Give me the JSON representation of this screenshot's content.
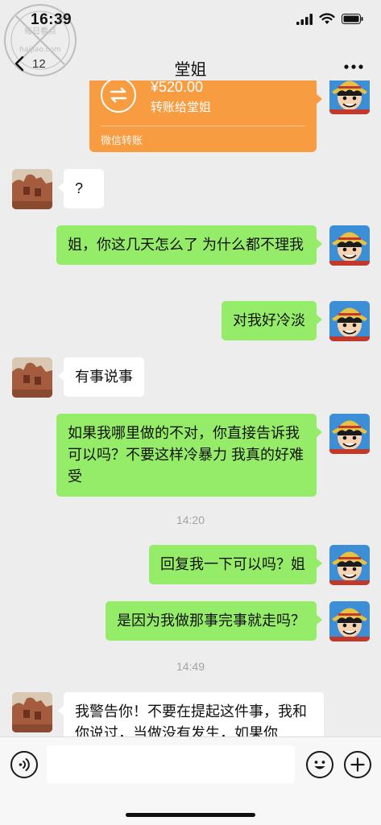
{
  "status": {
    "time": "16:39",
    "icons": [
      "cellular-signal-icon",
      "wifi-icon",
      "battery-icon"
    ]
  },
  "watermark": {
    "line1": "每日看点",
    "line2": "haijiao.com",
    "icon": "watermark-stamp"
  },
  "header": {
    "back_icon": "chevron-left-icon",
    "unread_count": "12",
    "title": "堂姐",
    "more_icon": "more-dots-icon"
  },
  "messages": {
    "transfer": {
      "amount": "¥520.00",
      "desc": "转账给堂姐",
      "footer": "微信转账",
      "icon": "transfer-arrows-icon"
    },
    "m1": "?",
    "m2": "姐，你这几天怎么了 为什么都不理我",
    "m3": "对我好冷淡",
    "m4": "有事说事",
    "m5": "如果我哪里做的不对，你直接告诉我可以吗？不要这样冷暴力 我真的好难受",
    "ts1": "14:20",
    "m6": "回复我一下可以吗？姐",
    "m7": "是因为我做那事完事就走吗？",
    "ts2": "14:49",
    "m8": "我警告你！不要在提起这件事，我和你说过，当做没有发生，如果你"
  },
  "input": {
    "voice_icon": "voice-icon",
    "placeholder": "",
    "emoji_icon": "emoji-icon",
    "plus_icon": "plus-icon"
  },
  "colors": {
    "background": "#ededed",
    "sent_bubble": "#95ec69",
    "received_bubble": "#ffffff",
    "transfer": "#f79c41"
  }
}
